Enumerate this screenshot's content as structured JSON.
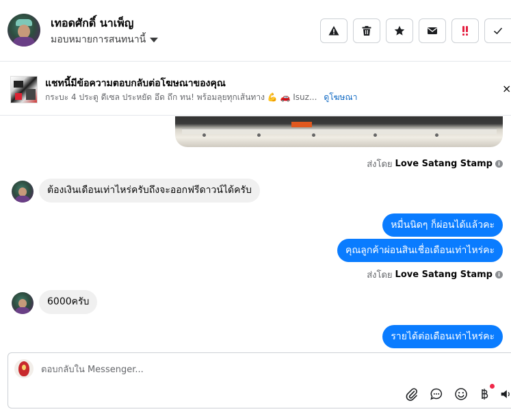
{
  "header": {
    "contact_name": "เทอดศักดิ์ นาเพ็ญ",
    "assign_label": "มอบหมายการสนทนานี้",
    "actions": [
      {
        "name": "report-button",
        "icon": "warning-icon"
      },
      {
        "name": "delete-button",
        "icon": "trash-icon"
      },
      {
        "name": "star-button",
        "icon": "star-icon"
      },
      {
        "name": "mark-unread-button",
        "icon": "envelope-icon"
      },
      {
        "name": "follow-up-button",
        "icon": "exclamation-icon"
      },
      {
        "name": "mark-done-button",
        "icon": "checkmark-icon"
      }
    ]
  },
  "ad_banner": {
    "title": "แชทนี้มีข้อความตอบกลับต่อโฆษณาของคุณ",
    "subtitle": "กระบะ 4 ประตู ดีเซล ประหยัด อึด ถึก ทน! พร้อมลุยทุกเส้นทาง 💪 🚗 Isuz...",
    "link_label": "ดูโฆษณา",
    "close_glyph": "×"
  },
  "thread": {
    "sent_by_prefix": "ส่งโดย",
    "sent_by_name": "Love Satang Stamp",
    "messages": [
      {
        "direction": "in",
        "text": "ต้องเงินเดือนเท่าไหร่ครับถึงจะออกฟรีดาวน์ได้ครับ"
      },
      {
        "direction": "out",
        "text": "หมื่นนิดๆ ก็ผ่อนได้แล้วคะ"
      },
      {
        "direction": "out",
        "text": "คุณลูกค้าผ่อนสินเชื่อเดือนเท่าไหร่คะ"
      },
      {
        "direction": "in",
        "text": "6000ครับ"
      },
      {
        "direction": "out",
        "text": "รายได้ต่อเดือนเท่าไหร่คะ"
      }
    ]
  },
  "composer": {
    "placeholder": "ตอบกลับใน Messenger...",
    "tools": [
      "attachment-icon",
      "saved-replies-icon",
      "emoji-icon",
      "baht-payment-icon",
      "audio-icon"
    ]
  },
  "colors": {
    "outgoing_bubble": "#0a7cff",
    "incoming_bubble": "#f0f0f0",
    "link": "#0a66c2",
    "notification_dot": "#f02849",
    "follow_up_icon": "#e41e3f"
  }
}
